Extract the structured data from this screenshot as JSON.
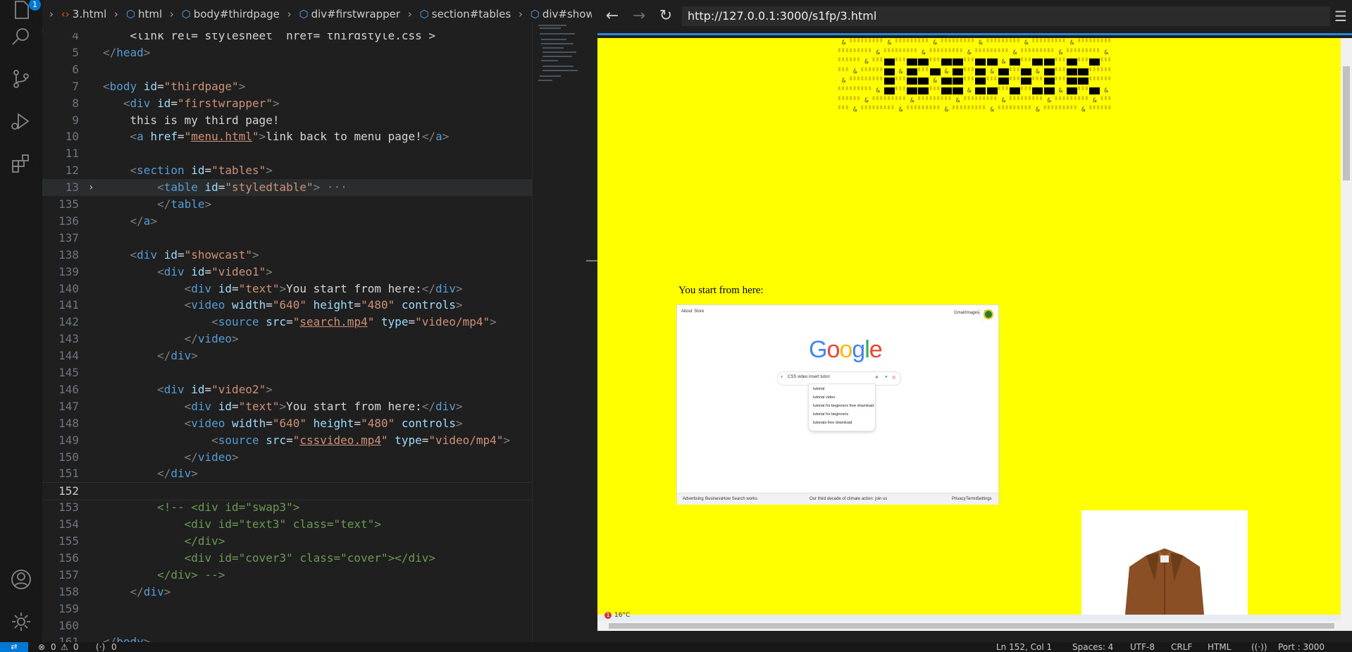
{
  "activity_bar": {
    "explorer_badge": "1",
    "icons": [
      "files-icon",
      "search-icon",
      "source-control-icon",
      "run-debug-icon",
      "extensions-icon",
      "account-icon",
      "settings-gear-icon"
    ]
  },
  "breadcrumb": {
    "items": [
      {
        "label": "3.html",
        "icon": "html-file-icon"
      },
      {
        "label": "html",
        "icon": "element-icon"
      },
      {
        "label": "body#thirdpage",
        "icon": "element-icon"
      },
      {
        "label": "div#firstwrapper",
        "icon": "element-icon"
      },
      {
        "label": "section#tables",
        "icon": "element-icon"
      },
      {
        "label": "div#showcast",
        "icon": "element-icon"
      }
    ]
  },
  "editor": {
    "current_line": "152",
    "lines": [
      {
        "n": "4",
        "tokens": [
          {
            "t": "    <link rel= stylesheet  href= thirdstyle.css >",
            "c": "tk-text"
          }
        ]
      },
      {
        "n": "5",
        "tokens": [
          {
            "t": "</",
            "c": "tk-bracket"
          },
          {
            "t": "head",
            "c": "tk-tag"
          },
          {
            "t": ">",
            "c": "tk-bracket"
          }
        ]
      },
      {
        "n": "6",
        "tokens": []
      },
      {
        "n": "7",
        "tokens": [
          {
            "t": "<",
            "c": "tk-bracket"
          },
          {
            "t": "body",
            "c": "tk-tag"
          },
          {
            "t": " id",
            "c": "tk-attr"
          },
          {
            "t": "=",
            "c": "tk-text"
          },
          {
            "t": "\"thirdpage\"",
            "c": "tk-str"
          },
          {
            "t": ">",
            "c": "tk-bracket"
          }
        ]
      },
      {
        "n": "8",
        "tokens": [
          {
            "t": "   <",
            "c": "tk-bracket"
          },
          {
            "t": "div",
            "c": "tk-tag"
          },
          {
            "t": " id",
            "c": "tk-attr"
          },
          {
            "t": "=",
            "c": "tk-text"
          },
          {
            "t": "\"firstwrapper\"",
            "c": "tk-str"
          },
          {
            "t": ">",
            "c": "tk-bracket"
          }
        ]
      },
      {
        "n": "9",
        "tokens": [
          {
            "t": "    this is my third page!",
            "c": "tk-text"
          }
        ]
      },
      {
        "n": "10",
        "tokens": [
          {
            "t": "    <",
            "c": "tk-bracket"
          },
          {
            "t": "a",
            "c": "tk-tag"
          },
          {
            "t": " href",
            "c": "tk-attr"
          },
          {
            "t": "=",
            "c": "tk-text"
          },
          {
            "t": "\"",
            "c": "tk-str"
          },
          {
            "t": "menu.html",
            "c": "tk-link"
          },
          {
            "t": "\"",
            "c": "tk-str"
          },
          {
            "t": ">",
            "c": "tk-bracket"
          },
          {
            "t": "link back to menu page!",
            "c": "tk-text"
          },
          {
            "t": "</",
            "c": "tk-bracket"
          },
          {
            "t": "a",
            "c": "tk-tag"
          },
          {
            "t": ">",
            "c": "tk-bracket"
          }
        ]
      },
      {
        "n": "11",
        "tokens": []
      },
      {
        "n": "12",
        "tokens": [
          {
            "t": "    <",
            "c": "tk-bracket"
          },
          {
            "t": "section",
            "c": "tk-tag"
          },
          {
            "t": " id",
            "c": "tk-attr"
          },
          {
            "t": "=",
            "c": "tk-text"
          },
          {
            "t": "\"tables\"",
            "c": "tk-str"
          },
          {
            "t": ">",
            "c": "tk-bracket"
          }
        ]
      },
      {
        "n": "13",
        "fold": true,
        "tokens": [
          {
            "t": "        <",
            "c": "tk-bracket"
          },
          {
            "t": "table",
            "c": "tk-tag"
          },
          {
            "t": " id",
            "c": "tk-attr"
          },
          {
            "t": "=",
            "c": "tk-text"
          },
          {
            "t": "\"styledtable\"",
            "c": "tk-str"
          },
          {
            "t": ">",
            "c": "tk-bracket"
          },
          {
            "t": " ···",
            "c": "tk-bracket"
          }
        ]
      },
      {
        "n": "135",
        "tokens": [
          {
            "t": "        </",
            "c": "tk-bracket"
          },
          {
            "t": "table",
            "c": "tk-tag"
          },
          {
            "t": ">",
            "c": "tk-bracket"
          }
        ]
      },
      {
        "n": "136",
        "tokens": [
          {
            "t": "    </",
            "c": "tk-bracket"
          },
          {
            "t": "a",
            "c": "tk-tag"
          },
          {
            "t": ">",
            "c": "tk-bracket"
          }
        ]
      },
      {
        "n": "137",
        "tokens": []
      },
      {
        "n": "138",
        "tokens": [
          {
            "t": "    <",
            "c": "tk-bracket"
          },
          {
            "t": "div",
            "c": "tk-tag"
          },
          {
            "t": " id",
            "c": "tk-attr"
          },
          {
            "t": "=",
            "c": "tk-text"
          },
          {
            "t": "\"showcast\"",
            "c": "tk-str"
          },
          {
            "t": ">",
            "c": "tk-bracket"
          }
        ]
      },
      {
        "n": "139",
        "tokens": [
          {
            "t": "        <",
            "c": "tk-bracket"
          },
          {
            "t": "div",
            "c": "tk-tag"
          },
          {
            "t": " id",
            "c": "tk-attr"
          },
          {
            "t": "=",
            "c": "tk-text"
          },
          {
            "t": "\"video1\"",
            "c": "tk-str"
          },
          {
            "t": ">",
            "c": "tk-bracket"
          }
        ]
      },
      {
        "n": "140",
        "tokens": [
          {
            "t": "            <",
            "c": "tk-bracket"
          },
          {
            "t": "div",
            "c": "tk-tag"
          },
          {
            "t": " id",
            "c": "tk-attr"
          },
          {
            "t": "=",
            "c": "tk-text"
          },
          {
            "t": "\"text\"",
            "c": "tk-str"
          },
          {
            "t": ">",
            "c": "tk-bracket"
          },
          {
            "t": "You start from here:",
            "c": "tk-text"
          },
          {
            "t": "</",
            "c": "tk-bracket"
          },
          {
            "t": "div",
            "c": "tk-tag"
          },
          {
            "t": ">",
            "c": "tk-bracket"
          }
        ]
      },
      {
        "n": "141",
        "tokens": [
          {
            "t": "            <",
            "c": "tk-bracket"
          },
          {
            "t": "video",
            "c": "tk-tag"
          },
          {
            "t": " width",
            "c": "tk-attr"
          },
          {
            "t": "=",
            "c": "tk-text"
          },
          {
            "t": "\"640\"",
            "c": "tk-str"
          },
          {
            "t": " height",
            "c": "tk-attr"
          },
          {
            "t": "=",
            "c": "tk-text"
          },
          {
            "t": "\"480\"",
            "c": "tk-str"
          },
          {
            "t": " controls",
            "c": "tk-attr"
          },
          {
            "t": ">",
            "c": "tk-bracket"
          }
        ]
      },
      {
        "n": "142",
        "tokens": [
          {
            "t": "                <",
            "c": "tk-bracket"
          },
          {
            "t": "source",
            "c": "tk-tag"
          },
          {
            "t": " src",
            "c": "tk-attr"
          },
          {
            "t": "=",
            "c": "tk-text"
          },
          {
            "t": "\"",
            "c": "tk-str"
          },
          {
            "t": "search.mp4",
            "c": "tk-link"
          },
          {
            "t": "\"",
            "c": "tk-str"
          },
          {
            "t": " type",
            "c": "tk-attr"
          },
          {
            "t": "=",
            "c": "tk-text"
          },
          {
            "t": "\"video/mp4\"",
            "c": "tk-str"
          },
          {
            "t": ">",
            "c": "tk-bracket"
          }
        ]
      },
      {
        "n": "143",
        "tokens": [
          {
            "t": "            </",
            "c": "tk-bracket"
          },
          {
            "t": "video",
            "c": "tk-tag"
          },
          {
            "t": ">",
            "c": "tk-bracket"
          }
        ]
      },
      {
        "n": "144",
        "tokens": [
          {
            "t": "        </",
            "c": "tk-bracket"
          },
          {
            "t": "div",
            "c": "tk-tag"
          },
          {
            "t": ">",
            "c": "tk-bracket"
          }
        ]
      },
      {
        "n": "145",
        "tokens": []
      },
      {
        "n": "146",
        "tokens": [
          {
            "t": "        <",
            "c": "tk-bracket"
          },
          {
            "t": "div",
            "c": "tk-tag"
          },
          {
            "t": " id",
            "c": "tk-attr"
          },
          {
            "t": "=",
            "c": "tk-text"
          },
          {
            "t": "\"video2\"",
            "c": "tk-str"
          },
          {
            "t": ">",
            "c": "tk-bracket"
          }
        ]
      },
      {
        "n": "147",
        "tokens": [
          {
            "t": "            <",
            "c": "tk-bracket"
          },
          {
            "t": "div",
            "c": "tk-tag"
          },
          {
            "t": " id",
            "c": "tk-attr"
          },
          {
            "t": "=",
            "c": "tk-text"
          },
          {
            "t": "\"text\"",
            "c": "tk-str"
          },
          {
            "t": ">",
            "c": "tk-bracket"
          },
          {
            "t": "You start from here:",
            "c": "tk-text"
          },
          {
            "t": "</",
            "c": "tk-bracket"
          },
          {
            "t": "div",
            "c": "tk-tag"
          },
          {
            "t": ">",
            "c": "tk-bracket"
          }
        ]
      },
      {
        "n": "148",
        "tokens": [
          {
            "t": "            <",
            "c": "tk-bracket"
          },
          {
            "t": "video",
            "c": "tk-tag"
          },
          {
            "t": " width",
            "c": "tk-attr"
          },
          {
            "t": "=",
            "c": "tk-text"
          },
          {
            "t": "\"640\"",
            "c": "tk-str"
          },
          {
            "t": " height",
            "c": "tk-attr"
          },
          {
            "t": "=",
            "c": "tk-text"
          },
          {
            "t": "\"480\"",
            "c": "tk-str"
          },
          {
            "t": " controls",
            "c": "tk-attr"
          },
          {
            "t": ">",
            "c": "tk-bracket"
          }
        ]
      },
      {
        "n": "149",
        "tokens": [
          {
            "t": "                <",
            "c": "tk-bracket"
          },
          {
            "t": "source",
            "c": "tk-tag"
          },
          {
            "t": " src",
            "c": "tk-attr"
          },
          {
            "t": "=",
            "c": "tk-text"
          },
          {
            "t": "\"",
            "c": "tk-str"
          },
          {
            "t": "cssvideo.mp4",
            "c": "tk-link"
          },
          {
            "t": "\"",
            "c": "tk-str"
          },
          {
            "t": " type",
            "c": "tk-attr"
          },
          {
            "t": "=",
            "c": "tk-text"
          },
          {
            "t": "\"video/mp4\"",
            "c": "tk-str"
          },
          {
            "t": ">",
            "c": "tk-bracket"
          }
        ]
      },
      {
        "n": "150",
        "tokens": [
          {
            "t": "            </",
            "c": "tk-bracket"
          },
          {
            "t": "video",
            "c": "tk-tag"
          },
          {
            "t": ">",
            "c": "tk-bracket"
          }
        ]
      },
      {
        "n": "151",
        "tokens": [
          {
            "t": "        </",
            "c": "tk-bracket"
          },
          {
            "t": "div",
            "c": "tk-tag"
          },
          {
            "t": ">",
            "c": "tk-bracket"
          }
        ]
      },
      {
        "n": "152",
        "tokens": []
      },
      {
        "n": "153",
        "tokens": [
          {
            "t": "        <!-- <div id=\"swap3\">",
            "c": "tk-cmt"
          }
        ]
      },
      {
        "n": "154",
        "tokens": [
          {
            "t": "            <div id=\"text3\" class=\"text\">",
            "c": "tk-cmt"
          }
        ]
      },
      {
        "n": "155",
        "tokens": [
          {
            "t": "            </div>",
            "c": "tk-cmt"
          }
        ]
      },
      {
        "n": "156",
        "tokens": [
          {
            "t": "            <div id=\"cover3\" class=\"cover\"></div>",
            "c": "tk-cmt"
          }
        ]
      },
      {
        "n": "157",
        "tokens": [
          {
            "t": "        </div> -->",
            "c": "tk-cmt"
          }
        ]
      },
      {
        "n": "158",
        "tokens": [
          {
            "t": "    </",
            "c": "tk-bracket"
          },
          {
            "t": "div",
            "c": "tk-tag"
          },
          {
            "t": ">",
            "c": "tk-bracket"
          }
        ]
      },
      {
        "n": "159",
        "tokens": []
      },
      {
        "n": "160",
        "tokens": []
      },
      {
        "n": "161",
        "tokens": [
          {
            "t": "</",
            "c": "tk-bracket"
          },
          {
            "t": "body",
            "c": "tk-tag"
          },
          {
            "t": ">",
            "c": "tk-bracket"
          }
        ]
      }
    ]
  },
  "browser": {
    "url": "http://127.0.0.1:3000/s1fp/3.html",
    "page": {
      "background": "#ffff00",
      "showcast_text": "You start from here:",
      "video1_preview": {
        "top_left_links": [
          "About",
          "Store"
        ],
        "top_right_links": [
          "Gmail",
          "Images"
        ],
        "logo": [
          "G",
          "o",
          "o",
          "g",
          "l",
          "e"
        ],
        "logo_colors": [
          "#4285F4",
          "#EA4335",
          "#FBBC05",
          "#4285F4",
          "#34A853",
          "#EA4335"
        ],
        "search_query": "CSS video insert tutori",
        "suggestions": [
          "tutorial",
          "tutorial video",
          "tutorial for beginners free download",
          "tutorial for beginners",
          "tutorials free download"
        ],
        "footer_left": [
          "Advertising",
          "Business",
          "How Search works"
        ],
        "footer_center": "Our third decade of climate action: join us",
        "footer_right": [
          "Privacy",
          "Terms",
          "Settings"
        ]
      }
    },
    "taskbar": {
      "weather": "16°C",
      "weather_badge": "1"
    }
  },
  "statusbar": {
    "problems": "0",
    "warnings": "0",
    "ports": "0",
    "position": "Ln 152, Col 1",
    "spaces": "Spaces: 4",
    "encoding": "UTF-8",
    "eol": "CRLF",
    "language": "HTML",
    "port": "Port : 3000"
  }
}
